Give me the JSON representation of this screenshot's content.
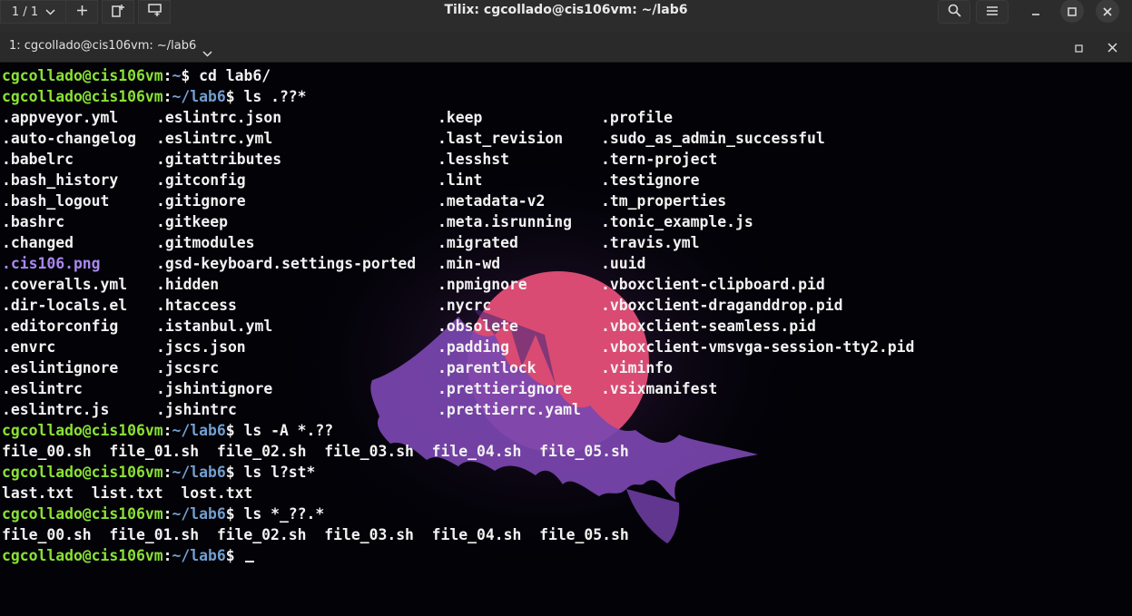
{
  "window": {
    "title": "Tilix: cgcollado@cis106vm: ~/lab6",
    "session_counter": "1 / 1",
    "controls": [
      "search-icon",
      "menu-icon",
      "minimize-icon",
      "maximize-icon",
      "close-icon"
    ]
  },
  "tab": {
    "label": "1: cgcollado@cis106vm: ~/lab6",
    "controls": [
      "maximize-terminal-icon",
      "close-terminal-icon"
    ]
  },
  "terminal": {
    "colors": {
      "background": "#020207",
      "user": "#8ae234",
      "path": "#729fcf",
      "image_file": "#a987f0",
      "text": "#f2f2f2"
    },
    "prompts": [
      {
        "user": "cgcollado@cis106vm",
        "path": "~",
        "command": "cd lab6/"
      },
      {
        "user": "cgcollado@cis106vm",
        "path": "~/lab6",
        "command": "ls .??*"
      },
      {
        "user": "cgcollado@cis106vm",
        "path": "~/lab6",
        "command": "ls -A *.??"
      },
      {
        "user": "cgcollado@cis106vm",
        "path": "~/lab6",
        "command": "ls l?st*"
      },
      {
        "user": "cgcollado@cis106vm",
        "path": "~/lab6",
        "command": "ls *_??.*"
      },
      {
        "user": "cgcollado@cis106vm",
        "path": "~/lab6",
        "command": ""
      }
    ],
    "listing": [
      [
        ".appveyor.yml",
        ".eslintrc.json",
        ".keep",
        ".profile"
      ],
      [
        ".auto-changelog",
        ".eslintrc.yml",
        ".last_revision",
        ".sudo_as_admin_successful"
      ],
      [
        ".babelrc",
        ".gitattributes",
        ".lesshst",
        ".tern-project"
      ],
      [
        ".bash_history",
        ".gitconfig",
        ".lint",
        ".testignore"
      ],
      [
        ".bash_logout",
        ".gitignore",
        ".metadata-v2",
        ".tm_properties"
      ],
      [
        ".bashrc",
        ".gitkeep",
        ".meta.isrunning",
        ".tonic_example.js"
      ],
      [
        ".changed",
        ".gitmodules",
        ".migrated",
        ".travis.yml"
      ],
      [
        ".cis106.png",
        ".gsd-keyboard.settings-ported",
        ".min-wd",
        ".uuid"
      ],
      [
        ".coveralls.yml",
        ".hidden",
        ".npmignore",
        ".vboxclient-clipboard.pid"
      ],
      [
        ".dir-locals.el",
        ".htaccess",
        ".nycrc",
        ".vboxclient-draganddrop.pid"
      ],
      [
        ".editorconfig",
        ".istanbul.yml",
        ".obsolete",
        ".vboxclient-seamless.pid"
      ],
      [
        ".envrc",
        ".jscs.json",
        ".padding",
        ".vboxclient-vmsvga-session-tty2.pid"
      ],
      [
        ".eslintignore",
        ".jscsrc",
        ".parentlock",
        ".viminfo"
      ],
      [
        ".eslintrc",
        ".jshintignore",
        ".prettierignore",
        ".vsixmanifest"
      ],
      [
        ".eslintrc.js",
        ".jshintrc",
        ".prettierrc.yaml",
        ""
      ]
    ],
    "outputs": {
      "ls_A": "file_00.sh  file_01.sh  file_02.sh  file_03.sh  file_04.sh  file_05.sh",
      "ls_lst": "last.txt  list.txt  lost.txt",
      "ls_underscore": "file_00.sh  file_01.sh  file_02.sh  file_03.sh  file_04.sh  file_05.sh"
    }
  }
}
